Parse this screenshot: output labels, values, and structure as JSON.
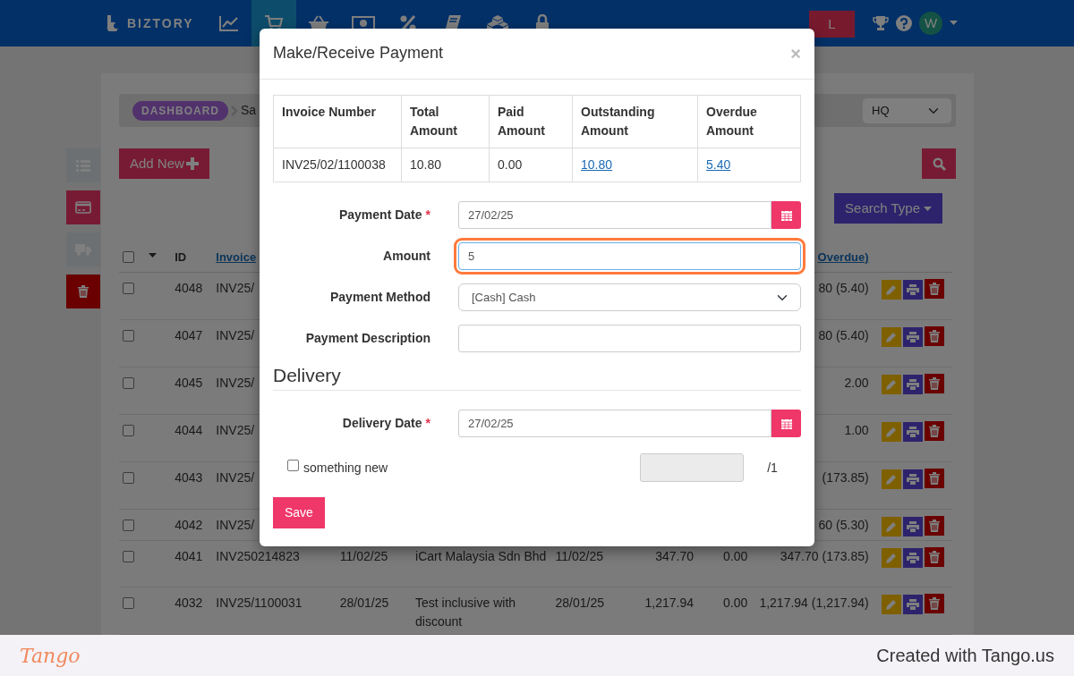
{
  "navbar": {
    "brand": "BIZTORY",
    "menu": [
      {
        "kind": "chart",
        "selected": false
      },
      {
        "kind": "cart",
        "selected": true
      },
      {
        "kind": "basket",
        "selected": false
      },
      {
        "kind": "money",
        "selected": false
      },
      {
        "kind": "percent",
        "selected": false
      },
      {
        "kind": "book",
        "selected": false
      },
      {
        "kind": "boxes",
        "selected": false
      },
      {
        "kind": "lock",
        "selected": false
      }
    ],
    "user_button": "L",
    "avatar": "W"
  },
  "side_actions": [
    {
      "kind": "list"
    },
    {
      "kind": "card"
    },
    {
      "kind": "truck"
    },
    {
      "kind": "trash"
    }
  ],
  "breadcrumb": {
    "root": "DASHBOARD",
    "current": "Sa"
  },
  "branch_select": "HQ",
  "add_button": "Add New",
  "search_type_button": "Search Type",
  "table": {
    "select_all_checked": false,
    "columns": {
      "id": "ID",
      "invoice": "Invoice",
      "outstanding": "Overdue)"
    },
    "rows": [
      {
        "checked": false,
        "id": "4048",
        "invoice": "INV25/",
        "outstanding": "80 (5.40)"
      },
      {
        "checked": false,
        "id": "4047",
        "invoice": "INV25/",
        "outstanding": "80 (5.40)"
      },
      {
        "checked": false,
        "id": "4045",
        "invoice": "INV25/",
        "outstanding": "2.00"
      },
      {
        "checked": false,
        "id": "4044",
        "invoice": "INV25/",
        "outstanding": "1.00"
      },
      {
        "checked": false,
        "id": "4043",
        "invoice": "INV25/",
        "outstanding": "(173.85)"
      },
      {
        "checked": false,
        "id": "4042",
        "invoice": "INV25/",
        "outstanding": "60 (5.30)"
      },
      {
        "checked": false,
        "id": "4041",
        "invoice": "INV250214823",
        "date": "11/02/25",
        "customer": "iCart Malaysia Sdn Bhd",
        "due_date": "11/02/25",
        "total": "347.70",
        "paid": "0.00",
        "outstanding": "347.70 (173.85)"
      },
      {
        "checked": false,
        "id": "4032",
        "invoice": "INV25/1100031",
        "date": "28/01/25",
        "customer": "Test inclusive with discount",
        "due_date": "28/01/25",
        "total": "1,217.94",
        "paid": "0.00",
        "outstanding": "1,217.94 (1,217.94)"
      }
    ]
  },
  "modal": {
    "title": "Make/Receive Payment",
    "close": "×",
    "summary": {
      "columns": [
        "Invoice Number",
        "Total Amount",
        "Paid Amount",
        "Outstanding Amount",
        "Overdue Amount"
      ],
      "cells": [
        {
          "text": "INV25/02/1100038",
          "link": false
        },
        {
          "text": "10.80",
          "link": false
        },
        {
          "text": "0.00",
          "link": false
        },
        {
          "text": "10.80",
          "link": true
        },
        {
          "text": "5.40",
          "link": true
        }
      ]
    },
    "fields": [
      {
        "kind": "date",
        "label": "Payment Date",
        "required_mark": "*",
        "value": "27/02/25",
        "focused": false
      },
      {
        "kind": "text",
        "label": "Amount",
        "value": "5",
        "focused": true
      },
      {
        "kind": "select",
        "label": "Payment Method",
        "value": "[Cash] Cash",
        "focused": false
      },
      {
        "kind": "text",
        "label": "Payment Description",
        "focused": false
      }
    ],
    "delivery": {
      "heading": "Delivery",
      "fields": [
        {
          "kind": "date",
          "label": "Delivery Date",
          "required_mark": "*",
          "value": "27/02/25",
          "focused": false
        }
      ],
      "items": [
        {
          "label": "something new",
          "checked": false,
          "quantity_disabled": true,
          "total": "/1"
        }
      ]
    },
    "save_button": "Save"
  },
  "footer": {
    "logo": "Tango",
    "text": "Created with Tango.us"
  }
}
